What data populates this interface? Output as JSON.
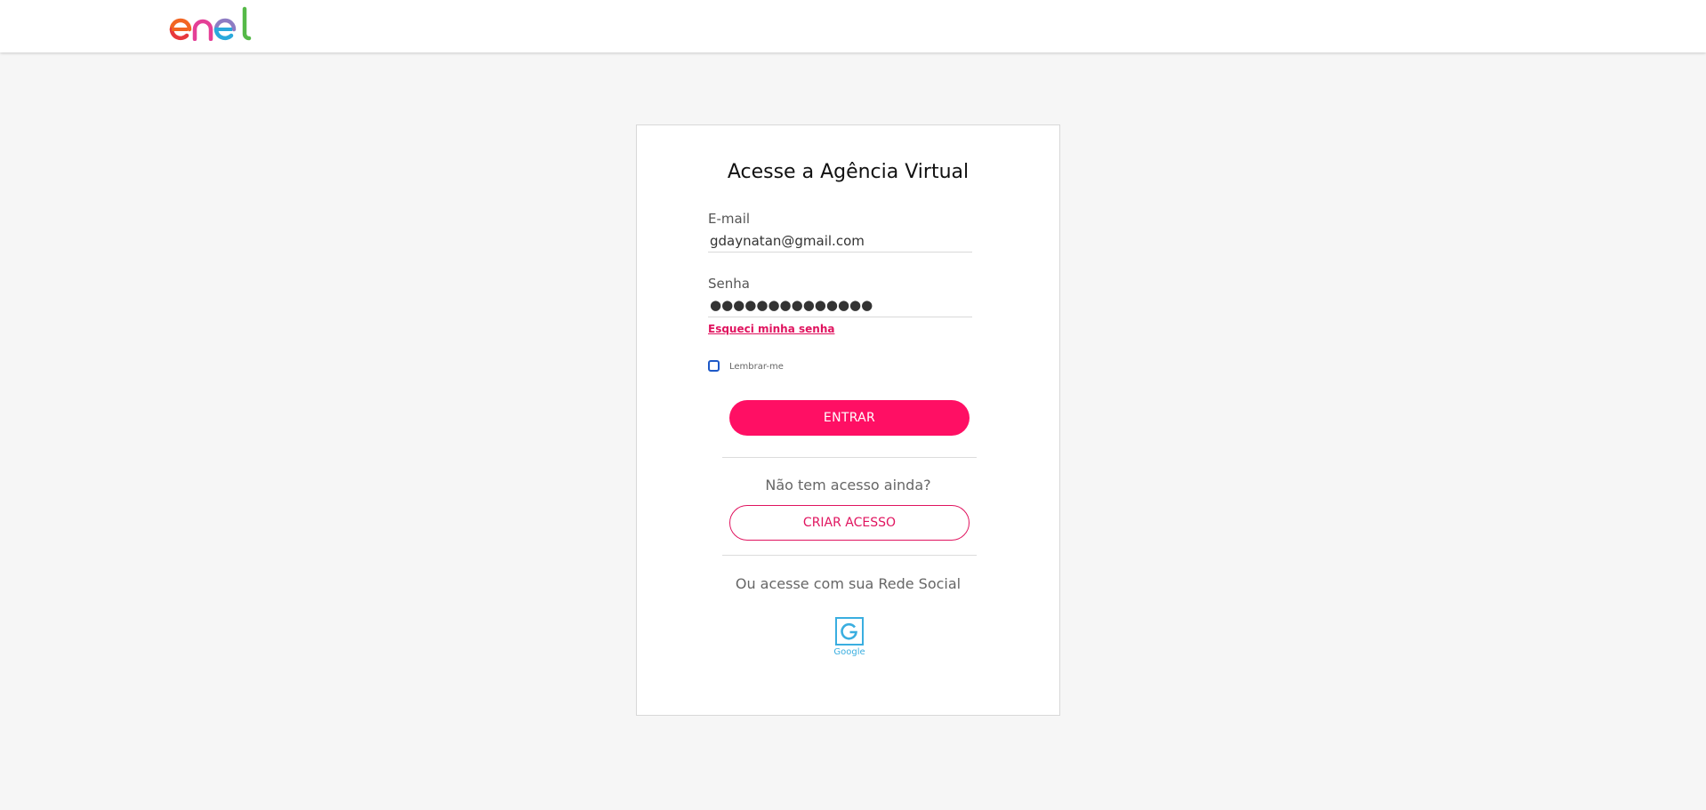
{
  "header": {
    "logo_text": "enel"
  },
  "login": {
    "title": "Acesse a Agência Virtual",
    "email_label": "E-mail",
    "email_value": "gdaynatan@gmail.com",
    "password_label": "Senha",
    "password_masked": "●●●●●●●●●●●●●●",
    "forgot_link": "Esqueci minha senha",
    "remember_label": "Lembrar-me",
    "remember_checked": false,
    "submit_label": "ENTRAR",
    "no_access_text": "Não tem acesso ainda?",
    "create_label": "CRIAR ACESSO",
    "social_text": "Ou acesse com sua Rede Social",
    "google_label": "Google"
  },
  "colors": {
    "brand_pink": "#ff0f64",
    "link_pink": "#e0145f",
    "checkbox_blue": "#1d58c7",
    "google_blue": "#3aaee0",
    "background": "#f6f6f6"
  },
  "icons": [
    "enel-logo",
    "google-icon"
  ]
}
